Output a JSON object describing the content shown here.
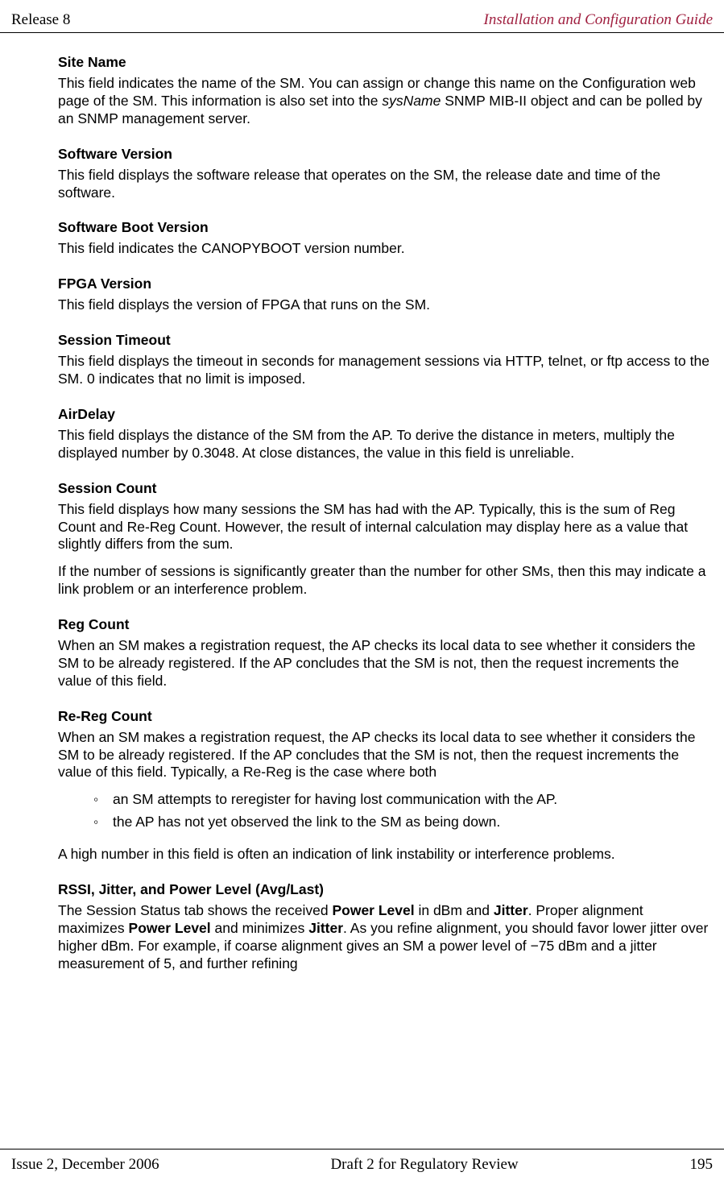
{
  "header": {
    "left": "Release 8",
    "right": "Installation and Configuration Guide"
  },
  "sections": {
    "siteName": {
      "title": "Site Name",
      "body_pre": "This field indicates the name of the SM. You can assign or change this name on the Configuration web page of the SM. This information is also set into the ",
      "body_italic": "sysName",
      "body_post": " SNMP MIB-II object and can be polled by an SNMP management server."
    },
    "softwareVersion": {
      "title": "Software Version",
      "body": "This field displays the software release that operates on the SM, the release date and time of the software."
    },
    "softwareBoot": {
      "title": "Software Boot Version",
      "body": "This field indicates the CANOPYBOOT version number."
    },
    "fpga": {
      "title": "FPGA Version",
      "body": "This field displays the version of FPGA that runs on the SM."
    },
    "sessionTimeout": {
      "title": "Session Timeout",
      "body": "This field displays the timeout in seconds for management sessions via HTTP, telnet, or ftp access to the SM. 0 indicates that no limit is imposed."
    },
    "airDelay": {
      "title": "AirDelay",
      "body": "This field displays the distance of the SM from the AP. To derive the distance in meters, multiply the displayed number by 0.3048. At close distances, the value in this field is unreliable."
    },
    "sessionCount": {
      "title": "Session Count",
      "body1": "This field displays how many sessions the SM has had with the AP. Typically, this is the sum of Reg Count and Re-Reg Count. However, the result of internal calculation may display here as a value that slightly differs from the sum.",
      "body2": "If the number of sessions is significantly greater than the number for other SMs, then this may indicate a link problem or an interference problem."
    },
    "regCount": {
      "title": "Reg Count",
      "body": "When an SM makes a registration request, the AP checks its local data to see whether it considers the SM to be already registered. If the AP concludes that the SM is not, then the request increments the value of this field."
    },
    "reRegCount": {
      "title": "Re-Reg Count",
      "body": "When an SM makes a registration request, the AP checks its local data to see whether it considers the SM to be already registered. If the AP concludes that the SM is not, then the request increments the value of this field. Typically, a Re-Reg is the case where both",
      "bullets": [
        "an SM attempts to reregister for having lost communication with the AP.",
        "the AP has not yet observed the link to the SM as being down."
      ],
      "body2": "A high number in this field is often an indication of link instability or interference problems."
    },
    "rssi": {
      "title": "RSSI, Jitter, and Power Level (Avg/Last)",
      "t1": "The Session Status tab shows the received ",
      "b1": "Power Level",
      "t2": " in dBm and ",
      "b2": "Jitter",
      "t3": ". Proper alignment maximizes ",
      "b3": "Power Level",
      "t4": " and minimizes ",
      "b4": "Jitter",
      "t5": ". As you refine alignment, you should favor lower jitter over higher dBm. For example, if coarse alignment gives an SM a power level of −75 dBm and a jitter measurement of 5, and further refining"
    }
  },
  "footer": {
    "left": "Issue 2, December 2006",
    "center": "Draft 2 for Regulatory Review",
    "right": "195"
  }
}
